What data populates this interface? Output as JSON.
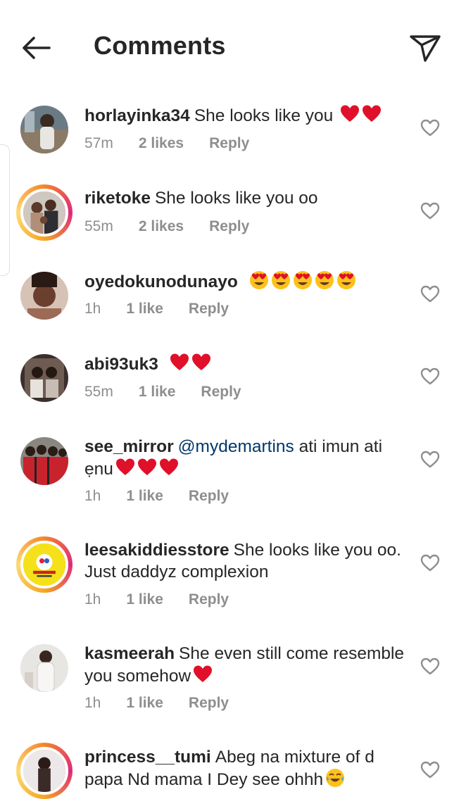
{
  "header": {
    "title": "Comments"
  },
  "comments": [
    {
      "username": "horlayinka34",
      "text": "She looks like you",
      "time": "57m",
      "likes": "2 likes",
      "reply": "Reply"
    },
    {
      "username": "riketoke",
      "text": "She looks like you oo",
      "time": "55m",
      "likes": "2 likes",
      "reply": "Reply"
    },
    {
      "username": "oyedokunodunayo",
      "text": "",
      "time": "1h",
      "likes": "1 like",
      "reply": "Reply"
    },
    {
      "username": "abi93uk3",
      "text": "",
      "time": "55m",
      "likes": "1 like",
      "reply": "Reply"
    },
    {
      "username": "see_mirror",
      "mention": "@mydemartins",
      "text": "ati imun ati ẹnu",
      "time": "1h",
      "likes": "1 like",
      "reply": "Reply"
    },
    {
      "username": "leesakiddiesstore",
      "text": "She looks like you oo. Just daddyz complexion",
      "time": "1h",
      "likes": "1 like",
      "reply": "Reply"
    },
    {
      "username": "kasmeerah",
      "text": "She even still come resemble you somehow",
      "time": "1h",
      "likes": "1 like",
      "reply": "Reply"
    },
    {
      "username": "princess__tumi",
      "text": "Abeg na mixture of d papa Nd mama I Dey see ohhh"
    }
  ],
  "colors": {
    "text": "#262626",
    "secondary": "#8e8e8e",
    "mention": "#00376b",
    "heart_emoji": "#e0102b"
  },
  "icons": [
    "back-arrow-icon",
    "send-icon",
    "heart-outline-icon",
    "red-heart-emoji",
    "heart-eyes-emoji",
    "tears-of-joy-emoji"
  ]
}
